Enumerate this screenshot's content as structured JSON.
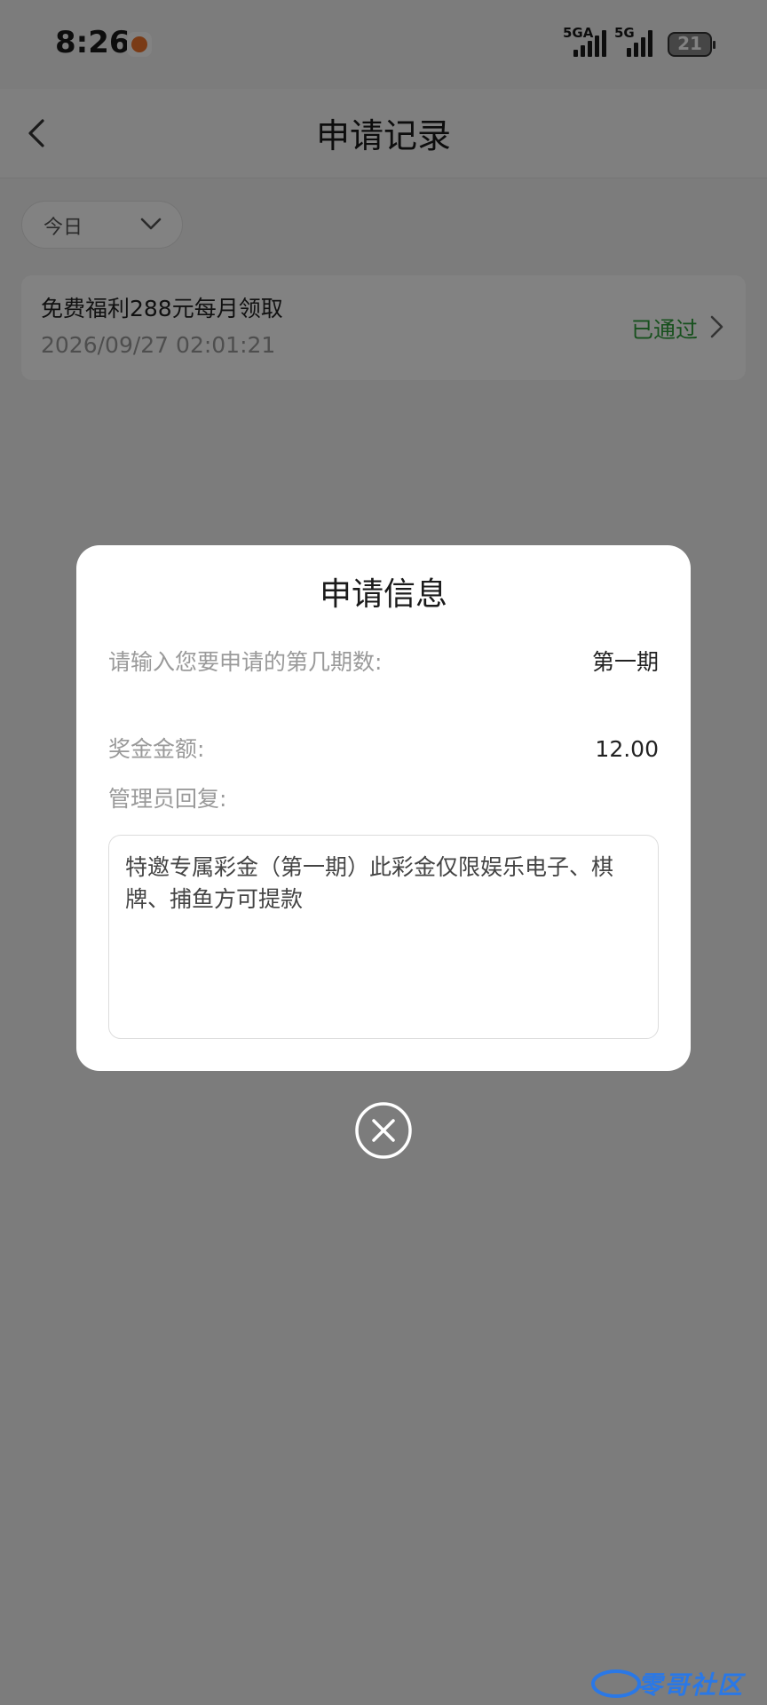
{
  "status_bar": {
    "time": "8:26",
    "sim1_label": "5GA",
    "sim2_label": "5G",
    "battery": "21"
  },
  "header": {
    "title": "申请记录"
  },
  "filter": {
    "selected": "今日"
  },
  "record": {
    "title": "免费福利288元每月领取",
    "datetime": "2026/09/27 02:01:21",
    "status": "已通过",
    "status_color": "#2e9e3a"
  },
  "dialog": {
    "title": "申请信息",
    "period_label": "请输入您要申请的第几期数:",
    "period_value": "第一期",
    "amount_label": "奖金金额:",
    "amount_value": "12.00",
    "reply_label": "管理员回复:",
    "reply_text": "特邀专属彩金（第一期）此彩金仅限娱乐电子、棋牌、捕鱼方可提款"
  },
  "watermark": {
    "text": "零哥社区"
  }
}
